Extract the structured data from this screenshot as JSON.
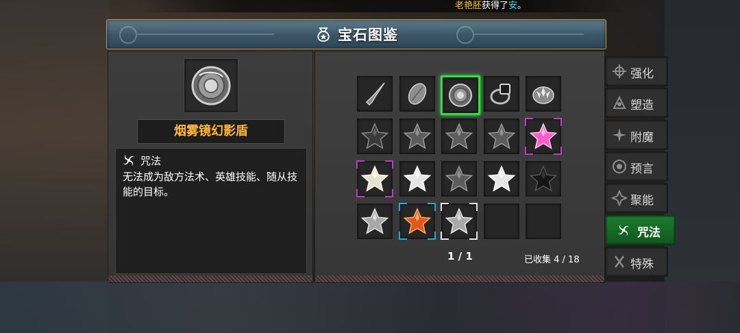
{
  "notice": {
    "player": "老艳胚",
    "text": "获得了",
    "item": "安",
    "end": "。"
  },
  "dialog": {
    "title": "宝石图鉴",
    "title_icon": "gem-bag-icon"
  },
  "selected_gem": {
    "name": "烟雾镜幻影盾",
    "icon": "round-shield-icon",
    "category_icon": "spiral-spell-icon",
    "category": "咒法",
    "description": "无法成为敌方法术、英雄技能、随从技能的目标。"
  },
  "grid": {
    "cells": [
      {
        "row": 0,
        "col": 0,
        "icon": "dagger-gem-icon",
        "state": "normal"
      },
      {
        "row": 0,
        "col": 1,
        "icon": "leaf-gem-icon",
        "state": "normal"
      },
      {
        "row": 0,
        "col": 2,
        "icon": "round-shield-icon",
        "state": "selected"
      },
      {
        "row": 0,
        "col": 3,
        "icon": "ring-gem-icon",
        "state": "normal"
      },
      {
        "row": 0,
        "col": 4,
        "icon": "crest-gem-icon",
        "state": "normal"
      },
      {
        "row": 1,
        "col": 0,
        "icon": "dark-star-icon",
        "state": "normal"
      },
      {
        "row": 1,
        "col": 1,
        "icon": "grey-star-icon",
        "state": "normal"
      },
      {
        "row": 1,
        "col": 2,
        "icon": "grey-star-icon",
        "state": "normal"
      },
      {
        "row": 1,
        "col": 3,
        "icon": "grey-star-icon",
        "state": "normal"
      },
      {
        "row": 1,
        "col": 4,
        "icon": "pink-star-icon",
        "state": "epic"
      },
      {
        "row": 2,
        "col": 0,
        "icon": "pearl-star-icon",
        "state": "epic"
      },
      {
        "row": 2,
        "col": 1,
        "icon": "white-star-icon",
        "state": "normal"
      },
      {
        "row": 2,
        "col": 2,
        "icon": "grey-star-icon",
        "state": "normal"
      },
      {
        "row": 2,
        "col": 3,
        "icon": "white-star-icon",
        "state": "normal"
      },
      {
        "row": 2,
        "col": 4,
        "icon": "black-star-icon",
        "state": "normal"
      },
      {
        "row": 3,
        "col": 0,
        "icon": "silver-star-icon",
        "state": "normal"
      },
      {
        "row": 3,
        "col": 1,
        "icon": "orange-star-icon",
        "state": "rare"
      },
      {
        "row": 3,
        "col": 2,
        "icon": "silver-star-icon",
        "state": "common"
      },
      {
        "row": 3,
        "col": 3,
        "icon": "",
        "state": "empty"
      },
      {
        "row": 3,
        "col": 4,
        "icon": "",
        "state": "empty"
      }
    ],
    "page": "1 / 1",
    "collected": "已收集 4 / 18"
  },
  "tabs": [
    {
      "label": "强化",
      "icon": "strengthen-icon",
      "active": false
    },
    {
      "label": "塑造",
      "icon": "shape-icon",
      "active": false
    },
    {
      "label": "附魔",
      "icon": "enchant-icon",
      "active": false
    },
    {
      "label": "预言",
      "icon": "prophecy-icon",
      "active": false
    },
    {
      "label": "聚能",
      "icon": "charge-icon",
      "active": false
    },
    {
      "label": "咒法",
      "icon": "spiral-spell-icon",
      "active": true
    },
    {
      "label": "特殊",
      "icon": "special-icon",
      "active": false
    }
  ],
  "colors": {
    "selected_border": "#30e040",
    "epic_corner": "#c238c8",
    "rare_corner": "#2aa7d8",
    "common_corner": "#e8e8e8",
    "name_color": "#ffb53a",
    "active_tab": "#1d7b2e"
  }
}
